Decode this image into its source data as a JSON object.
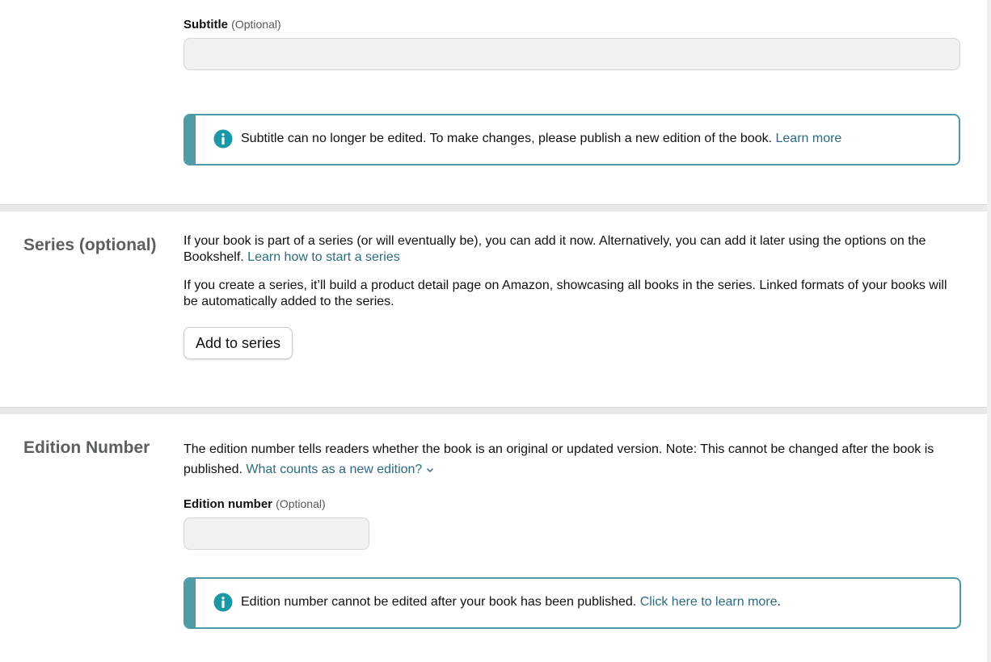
{
  "subtitle": {
    "label": "Subtitle",
    "optional": "(Optional)",
    "value": "",
    "notice": {
      "text": "Subtitle can no longer be edited. To make changes, please publish a new edition of the book.",
      "link": "Learn more"
    }
  },
  "series": {
    "title": "Series (optional)",
    "para1": "If your book is part of a series (or will eventually be), you can add it now. Alternatively, you can add it later using the options on the Bookshelf.",
    "para1_link": "Learn how to start a series",
    "para2": "If you create a series, it’ll build a product detail page on Amazon, showcasing all books in the series. Linked formats of your books will be automatically added to the series.",
    "button": "Add to series"
  },
  "edition": {
    "title": "Edition Number",
    "description": "The edition number tells readers whether the book is an original or updated version. Note: This cannot be changed after the book is published.",
    "description_link": "What counts as a new edition?",
    "field_label": "Edition number",
    "field_optional": "(Optional)",
    "value": "",
    "notice": {
      "text": "Edition number cannot be edited after your book has been published.",
      "link": "Click here to learn more",
      "suffix": "."
    }
  },
  "colors": {
    "accent": "#4f9aa5",
    "link": "#2c6b80",
    "info_icon": "#1a98a6"
  },
  "icons": {
    "info": "info-icon",
    "chevron": "chevron-down-icon"
  }
}
